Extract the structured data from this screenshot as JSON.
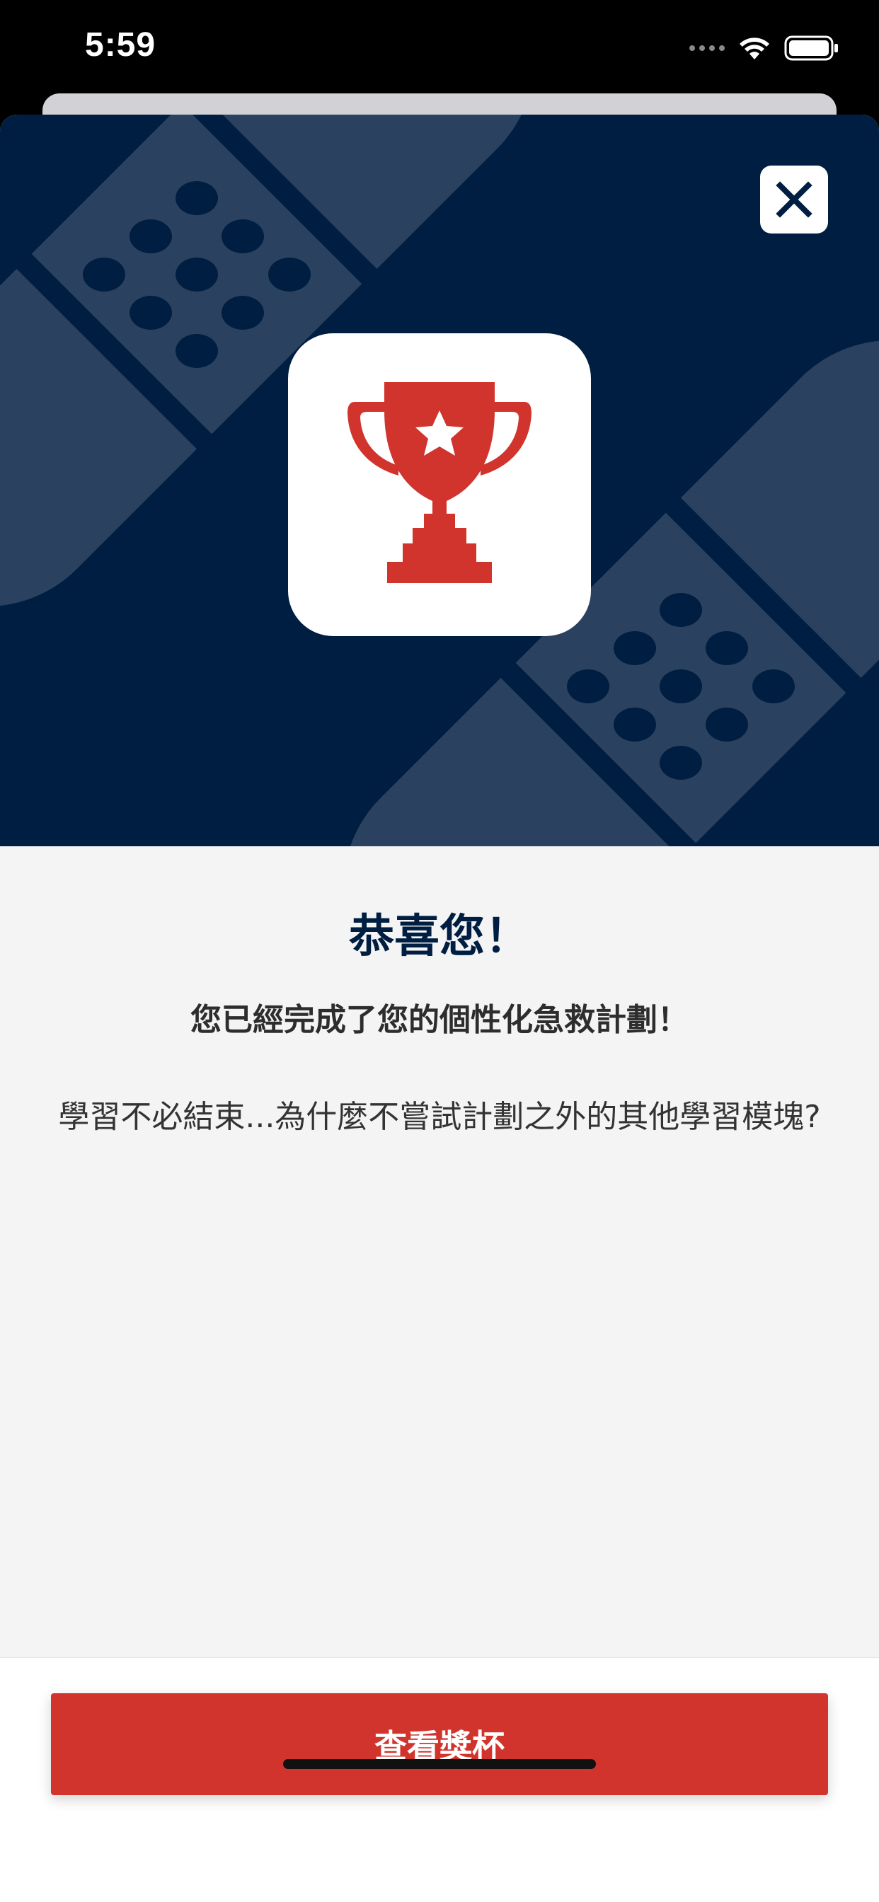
{
  "status_bar": {
    "time": "5:59"
  },
  "modal": {
    "close_icon": "close-x-icon",
    "badge_icon": "trophy-icon",
    "title": "恭喜您！",
    "subtitle": "您已經完成了您的個性化急救計劃！",
    "body": "學習不必結束...為什麼不嘗試計劃之外的其他學習模塊?",
    "primary_button": "查看獎杯"
  },
  "colors": {
    "hero_background": "#001e41",
    "hero_pattern": "#2a4260",
    "accent_red": "#d0342c",
    "title_navy": "#001e41",
    "page_background": "#f4f4f5"
  }
}
